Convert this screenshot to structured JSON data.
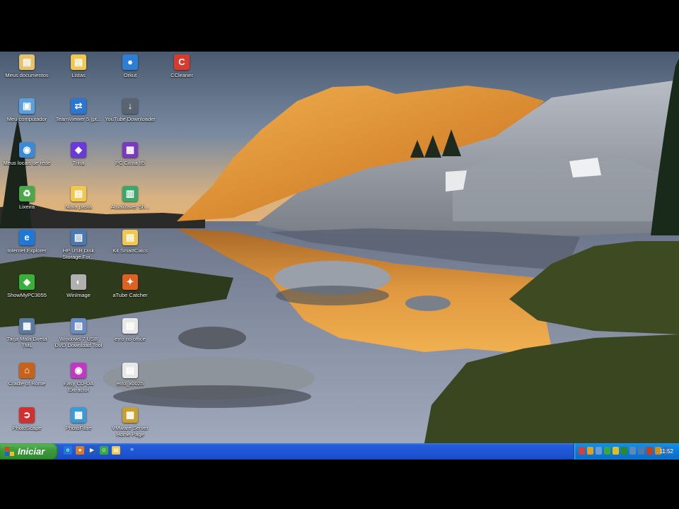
{
  "desktop": {
    "icons": [
      {
        "label": "Meus documentos",
        "icon": "folder-docs-icon",
        "color": "#e8c26a",
        "glyph": "▤"
      },
      {
        "label": "Listas",
        "icon": "folder-icon",
        "color": "#f0c850",
        "glyph": "▤"
      },
      {
        "label": "Orkut",
        "icon": "orkut-icon",
        "color": "#2d7fd4",
        "glyph": "●"
      },
      {
        "label": "CCleaner",
        "icon": "ccleaner-icon",
        "color": "#d93a2b",
        "glyph": "C"
      },
      {
        "label": "Meu computador",
        "icon": "computer-icon",
        "color": "#5aa0e0",
        "glyph": "▣"
      },
      {
        "label": "TeamViewer 5 (pt...",
        "icon": "teamviewer-icon",
        "color": "#2a76d2",
        "glyph": "⇄"
      },
      {
        "label": "YouTube Downloader",
        "icon": "downloader-icon",
        "color": "#5a6470",
        "glyph": "↓"
      },
      {
        "label": "Meus locais de rede",
        "icon": "network-icon",
        "color": "#3a8ad8",
        "glyph": "◉"
      },
      {
        "label": "Trina",
        "icon": "app-icon",
        "color": "#6a3ad8",
        "glyph": "◆"
      },
      {
        "label": "PC Cilma 85",
        "icon": "app-icon",
        "color": "#7a3ac0",
        "glyph": "▦"
      },
      {
        "label": "Lixeira",
        "icon": "recycle-bin-icon",
        "color": "#4aa84a",
        "glyph": "♻"
      },
      {
        "label": "Nova pasta",
        "icon": "folder-icon",
        "color": "#f0c850",
        "glyph": "▤"
      },
      {
        "label": "Atualizaver Sh...",
        "icon": "app-icon",
        "color": "#3aa86a",
        "glyph": "▥"
      },
      {
        "label": "Internet Explorer",
        "icon": "internet-explorer-icon",
        "color": "#1e78d8",
        "glyph": "e"
      },
      {
        "label": "HP USB Disk Storage For...",
        "icon": "hp-usb-icon",
        "color": "#4a78b0",
        "glyph": "▨"
      },
      {
        "label": "Kit SmartCalcs",
        "icon": "folder-icon",
        "color": "#f0c850",
        "glyph": "▤"
      },
      {
        "label": "ShowMyPC3055",
        "icon": "showmypc-icon",
        "color": "#3ab03a",
        "glyph": "◆"
      },
      {
        "label": "WinImage",
        "icon": "winimage-icon",
        "color": "#b0b0b0",
        "glyph": "◐"
      },
      {
        "label": "aTube Catcher",
        "icon": "atube-catcher-icon",
        "color": "#e06020",
        "glyph": "✦"
      },
      {
        "label": "Tarja Mala Direta TML",
        "icon": "app-icon",
        "color": "#5a7aa0",
        "glyph": "▦"
      },
      {
        "label": "Windows 7 USB DVD Download Tool",
        "icon": "usb-tool-icon",
        "color": "#6a8ac0",
        "glyph": "▧"
      },
      {
        "label": "erro no office",
        "icon": "document-icon",
        "color": "#e8e8e8",
        "glyph": "▤"
      },
      {
        "label": "Cradle of Rome",
        "icon": "game-icon",
        "color": "#c8621a",
        "glyph": "⌂"
      },
      {
        "label": "Easy CD-DA Extractor",
        "icon": "cd-extractor-icon",
        "color": "#c03ac0",
        "glyph": "◉"
      },
      {
        "label": "erro_x0025",
        "icon": "document-icon",
        "color": "#e8e8e8",
        "glyph": "▤"
      },
      {
        "label": "PhotoScape",
        "icon": "photoscape-icon",
        "color": "#d03030",
        "glyph": "➲"
      },
      {
        "label": "PhotoFiltre",
        "icon": "photofiltre-icon",
        "color": "#3a9ad8",
        "glyph": "▩"
      },
      {
        "label": "VMware Server Home Page",
        "icon": "vmware-icon",
        "color": "#c8a030",
        "glyph": "▦"
      }
    ]
  },
  "taskbar": {
    "start_label": "Iniciar",
    "quick_launch": [
      {
        "icon": "internet-explorer-icon",
        "color": "#1e78d8",
        "glyph": "e"
      },
      {
        "icon": "firefox-icon",
        "color": "#e07a20",
        "glyph": "●"
      },
      {
        "icon": "media-player-icon",
        "color": "#2a5ab0",
        "glyph": "▶"
      },
      {
        "icon": "messenger-icon",
        "color": "#3aa83a",
        "glyph": "☺"
      },
      {
        "icon": "folder-icon",
        "color": "#f0c850",
        "glyph": "▤"
      }
    ],
    "tray_icons": [
      {
        "icon": "network-icon",
        "color": "#d04040"
      },
      {
        "icon": "antivirus-icon",
        "color": "#e0a020"
      },
      {
        "icon": "volume-icon",
        "color": "#6a9ad8"
      },
      {
        "icon": "messenger-icon",
        "color": "#3aa83a"
      },
      {
        "icon": "update-icon",
        "color": "#e0c020"
      },
      {
        "icon": "shield-icon",
        "color": "#2a8a2a"
      },
      {
        "icon": "safely-remove-icon",
        "color": "#5a8ac0"
      },
      {
        "icon": "settings-icon",
        "color": "#4a7ab0"
      },
      {
        "icon": "app-icon",
        "color": "#c04020"
      },
      {
        "icon": "app-icon",
        "color": "#d09020"
      },
      {
        "icon": "app-icon",
        "color": "#3a6ab0"
      }
    ],
    "clock": "11:52"
  }
}
